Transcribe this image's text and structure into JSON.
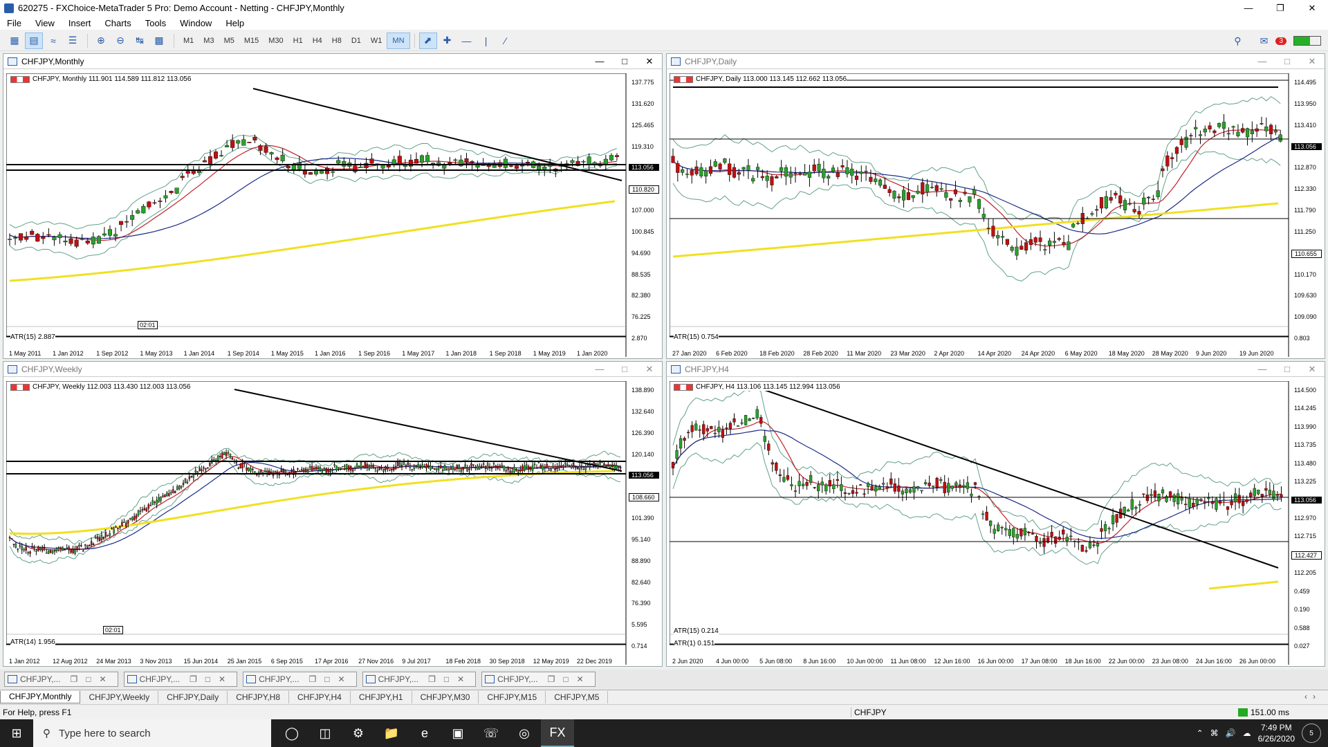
{
  "window": {
    "title": "620275 - FXChoice-MetaTrader 5 Pro: Demo Account - Netting - CHFJPY,Monthly"
  },
  "menu": [
    "File",
    "View",
    "Insert",
    "Charts",
    "Tools",
    "Window",
    "Help"
  ],
  "timeframes": [
    "M1",
    "M3",
    "M5",
    "M15",
    "M30",
    "H1",
    "H4",
    "H8",
    "D1",
    "W1",
    "MN"
  ],
  "active_timeframe": "MN",
  "notifications_badge": "3",
  "charts": {
    "monthly": {
      "caption": "CHFJPY,Monthly",
      "ohlc": "CHFJPY, Monthly  111.901 114.589 111.812 113.056",
      "indicator": "ATR(15) 2.887",
      "prices": [
        "137.775",
        "131.620",
        "125.465",
        "119.310",
        "113.056",
        "110.820",
        "107.000",
        "100.845",
        "94.690",
        "88.535",
        "82.380",
        "76.225",
        "2.870"
      ],
      "xlabels": [
        "1 May 2011",
        "1 Jan 2012",
        "1 Sep 2012",
        "1 May 2013",
        "1 Jan 2014",
        "1 Sep 2014",
        "1 May 2015",
        "1 Jan 2016",
        "1 Sep 2016",
        "1 May 2017",
        "1 Jan 2018",
        "1 Sep 2018",
        "1 May 2019",
        "1 Jan 2020"
      ],
      "bookmark": "02:01"
    },
    "daily": {
      "caption": "CHFJPY,Daily",
      "ohlc": "CHFJPY, Daily  113.000 113.145 112.662 113.056",
      "indicator": "ATR(15) 0.754",
      "prices": [
        "114.495",
        "113.950",
        "113.410",
        "113.056",
        "112.870",
        "112.330",
        "111.790",
        "111.250",
        "110.655",
        "110.170",
        "109.630",
        "109.090",
        "0.803"
      ],
      "xlabels": [
        "27 Jan 2020",
        "6 Feb 2020",
        "18 Feb 2020",
        "28 Feb 2020",
        "11 Mar 2020",
        "23 Mar 2020",
        "2 Apr 2020",
        "14 Apr 2020",
        "24 Apr 2020",
        "6 May 2020",
        "18 May 2020",
        "28 May 2020",
        "9 Jun 2020",
        "19 Jun 2020"
      ]
    },
    "weekly": {
      "caption": "CHFJPY,Weekly",
      "ohlc": "CHFJPY, Weekly  112.003 113.430 112.003 113.056",
      "indicator": "ATR(14) 1.956",
      "prices": [
        "138.890",
        "132.640",
        "126.390",
        "120.140",
        "113.056",
        "108.660",
        "101.390",
        "95.140",
        "88.890",
        "82.640",
        "76.390",
        "5.595",
        "0.714"
      ],
      "xlabels": [
        "1 Jan 2012",
        "12 Aug 2012",
        "24 Mar 2013",
        "3 Nov 2013",
        "15 Jun 2014",
        "25 Jan 2015",
        "6 Sep 2015",
        "17 Apr 2016",
        "27 Nov 2016",
        "9 Jul 2017",
        "18 Feb 2018",
        "30 Sep 2018",
        "12 May 2019",
        "22 Dec 2019"
      ],
      "bookmark": "02:01"
    },
    "h4": {
      "caption": "CHFJPY,H4",
      "ohlc": "CHFJPY, H4  113.106 113.145 112.994 113.056",
      "indicator1": "ATR(15) 0.214",
      "indicator2": "ATR(1) 0.151",
      "prices": [
        "114.500",
        "114.245",
        "113.990",
        "113.735",
        "113.480",
        "113.225",
        "113.056",
        "112.970",
        "112.715",
        "112.427",
        "112.205",
        "0.459",
        "0.190",
        "0.588",
        "0.027"
      ],
      "xlabels": [
        "2 Jun 2020",
        "4 Jun 00:00",
        "5 Jun 08:00",
        "8 Jun 16:00",
        "10 Jun 00:00",
        "11 Jun 08:00",
        "12 Jun 16:00",
        "16 Jun 00:00",
        "17 Jun 08:00",
        "18 Jun 16:00",
        "22 Jun 00:00",
        "23 Jun 08:00",
        "24 Jun 16:00",
        "26 Jun 00:00"
      ]
    }
  },
  "minimized": [
    "CHFJPY,...",
    "CHFJPY,...",
    "CHFJPY,...",
    "CHFJPY,...",
    "CHFJPY,..."
  ],
  "tabs": [
    "CHFJPY,Monthly",
    "CHFJPY,Weekly",
    "CHFJPY,Daily",
    "CHFJPY,H8",
    "CHFJPY,H4",
    "CHFJPY,H1",
    "CHFJPY,M30",
    "CHFJPY,M15",
    "CHFJPY,M5"
  ],
  "status": {
    "help": "For Help, press F1",
    "symbol": "CHFJPY",
    "ping": "151.00 ms"
  },
  "taskbar": {
    "search_placeholder": "Type here to search",
    "time": "7:49 PM",
    "date": "6/26/2020",
    "notif_count": "5"
  }
}
